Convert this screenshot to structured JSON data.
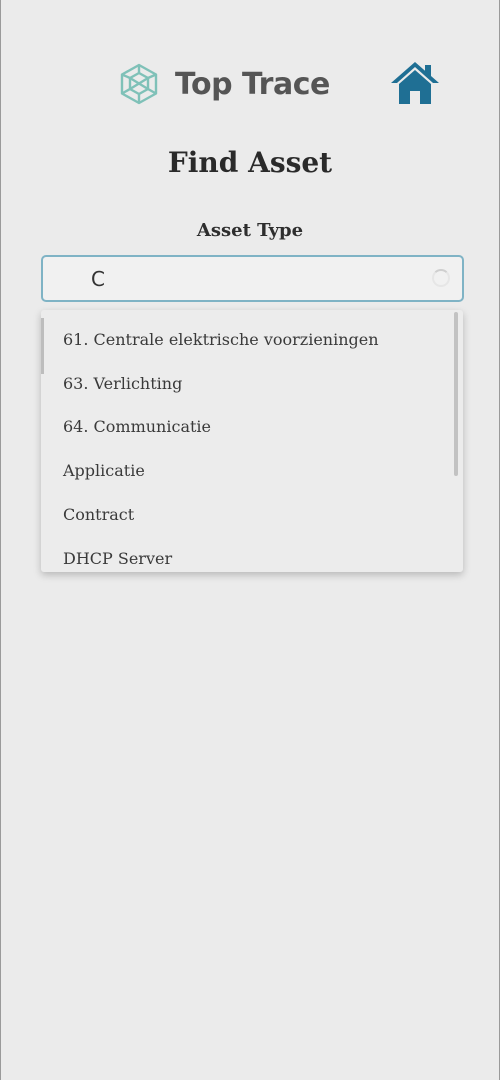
{
  "header": {
    "brand_name": "Top Trace",
    "logo_icon": "cube-outline-icon",
    "home_icon": "home-icon",
    "brand_color": "#7fc1b8",
    "home_color": "#1f6f94"
  },
  "page": {
    "title": "Find Asset"
  },
  "asset_type": {
    "label": "Asset Type",
    "value": "C",
    "loading": true,
    "focus_color": "#7fb3c5",
    "options": [
      "61. Centrale elektrische voorzieningen",
      "63. Verlichting",
      "64. Communicatie",
      "Applicatie",
      "Contract",
      "DHCP Server"
    ]
  }
}
